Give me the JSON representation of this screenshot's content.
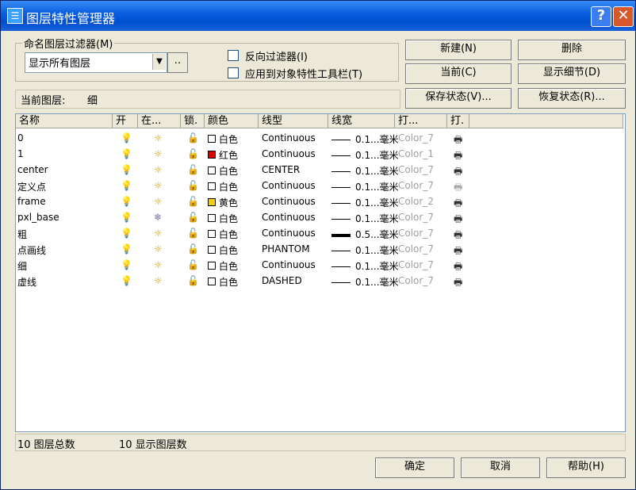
{
  "window": {
    "title": "图层特性管理器",
    "help_label": "?",
    "close_label": "✕"
  },
  "filter": {
    "legend": "命名图层过滤器(M)",
    "selected": "显示所有图层",
    "dots_label": "‥",
    "invert_label": "反向过滤器(I)",
    "apply_toolbar_label": "应用到对象特性工具栏(T)"
  },
  "buttons": {
    "new": "新建(N)",
    "delete": "删除",
    "current": "当前(C)",
    "show_details": "显示细节(D)",
    "save_state": "保存状态(V)...",
    "restore_state": "恢复状态(R)...",
    "ok": "确定",
    "cancel": "取消",
    "help": "帮助(H)"
  },
  "current_layer": {
    "label": "当前图层:",
    "value": "细"
  },
  "columns": [
    "名称",
    "开",
    "在...",
    "锁.",
    "颜色",
    "线型",
    "线宽",
    "打...",
    "打."
  ],
  "layers": [
    {
      "name": "0",
      "on": "bulb-on-icon",
      "freeze": "sun-icon",
      "color_hex": "#ffffff",
      "color_name": "白色",
      "linetype": "Continuous",
      "lineweight": "0.1...毫米",
      "thick": false,
      "plot_style": "Color_7",
      "plot": "printer-icon"
    },
    {
      "name": "1",
      "on": "bulb-on-icon",
      "freeze": "sun-icon",
      "color_hex": "#e00000",
      "color_name": "红色",
      "linetype": "Continuous",
      "lineweight": "0.1...毫米",
      "thick": false,
      "plot_style": "Color_1",
      "plot": "printer-icon"
    },
    {
      "name": "center",
      "on": "bulb-on-icon",
      "freeze": "sun-icon",
      "color_hex": "#ffffff",
      "color_name": "白色",
      "linetype": "CENTER",
      "lineweight": "0.1...毫米",
      "thick": false,
      "plot_style": "Color_7",
      "plot": "printer-icon"
    },
    {
      "name": "定义点",
      "on": "bulb-on-icon",
      "freeze": "sun-icon",
      "color_hex": "#ffffff",
      "color_name": "白色",
      "linetype": "Continuous",
      "lineweight": "0.1...毫米",
      "thick": false,
      "plot_style": "Color_7",
      "plot": "printer-disabled-icon"
    },
    {
      "name": "frame",
      "on": "bulb-on-icon",
      "freeze": "sun-icon",
      "color_hex": "#f0d000",
      "color_name": "黄色",
      "linetype": "Continuous",
      "lineweight": "0.1...毫米",
      "thick": false,
      "plot_style": "Color_2",
      "plot": "printer-icon"
    },
    {
      "name": "pxl_base",
      "on": "bulb-on-icon",
      "freeze": "snowflake-icon",
      "color_hex": "#ffffff",
      "color_name": "白色",
      "linetype": "Continuous",
      "lineweight": "0.1...毫米",
      "thick": false,
      "plot_style": "Color_7",
      "plot": "printer-icon"
    },
    {
      "name": "粗",
      "on": "bulb-on-icon",
      "freeze": "sun-icon",
      "color_hex": "#ffffff",
      "color_name": "白色",
      "linetype": "Continuous",
      "lineweight": "0.5...毫米",
      "thick": true,
      "plot_style": "Color_7",
      "plot": "printer-icon"
    },
    {
      "name": "点画线",
      "on": "bulb-on-icon",
      "freeze": "sun-icon",
      "color_hex": "#ffffff",
      "color_name": "白色",
      "linetype": "PHANTOM",
      "lineweight": "0.1...毫米",
      "thick": false,
      "plot_style": "Color_7",
      "plot": "printer-icon"
    },
    {
      "name": "细",
      "on": "bulb-on-icon",
      "freeze": "sun-icon",
      "color_hex": "#ffffff",
      "color_name": "白色",
      "linetype": "Continuous",
      "lineweight": "0.1...毫米",
      "thick": false,
      "plot_style": "Color_7",
      "plot": "printer-icon"
    },
    {
      "name": "虚线",
      "on": "bulb-on-icon",
      "freeze": "sun-icon",
      "color_hex": "#ffffff",
      "color_name": "白色",
      "linetype": "DASHED",
      "lineweight": "0.1...毫米",
      "thick": false,
      "plot_style": "Color_7",
      "plot": "printer-icon"
    }
  ],
  "status": {
    "total": "10 图层总数",
    "shown": "10 显示图层数"
  }
}
